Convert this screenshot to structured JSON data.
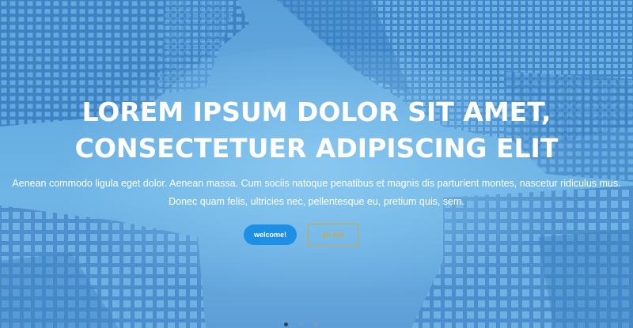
{
  "hero": {
    "headline_line1": "LOREM IPSUM DOLOR SIT AMET,",
    "headline_line2": "CONSECTETUER ADIPISCING ELIT",
    "paragraph_line1": "Aenean commodo ligula eget dolor. Aenean massa. Cum sociis natoque penatibus et magnis dis parturient montes, nascetur ridiculus mus.",
    "paragraph_line2": "Donec quam felis, ultricies nec, pellentesque eu, pretium quis, sem.",
    "primary_button_label": "welcome!",
    "secondary_button_label": "yo ho!",
    "primary_button_color": "#1d8fe5",
    "secondary_button_color": "#d4a537",
    "overlay_color": "#5a9fd8"
  },
  "carousel": {
    "slide_count": 3,
    "active_slide": 1
  }
}
